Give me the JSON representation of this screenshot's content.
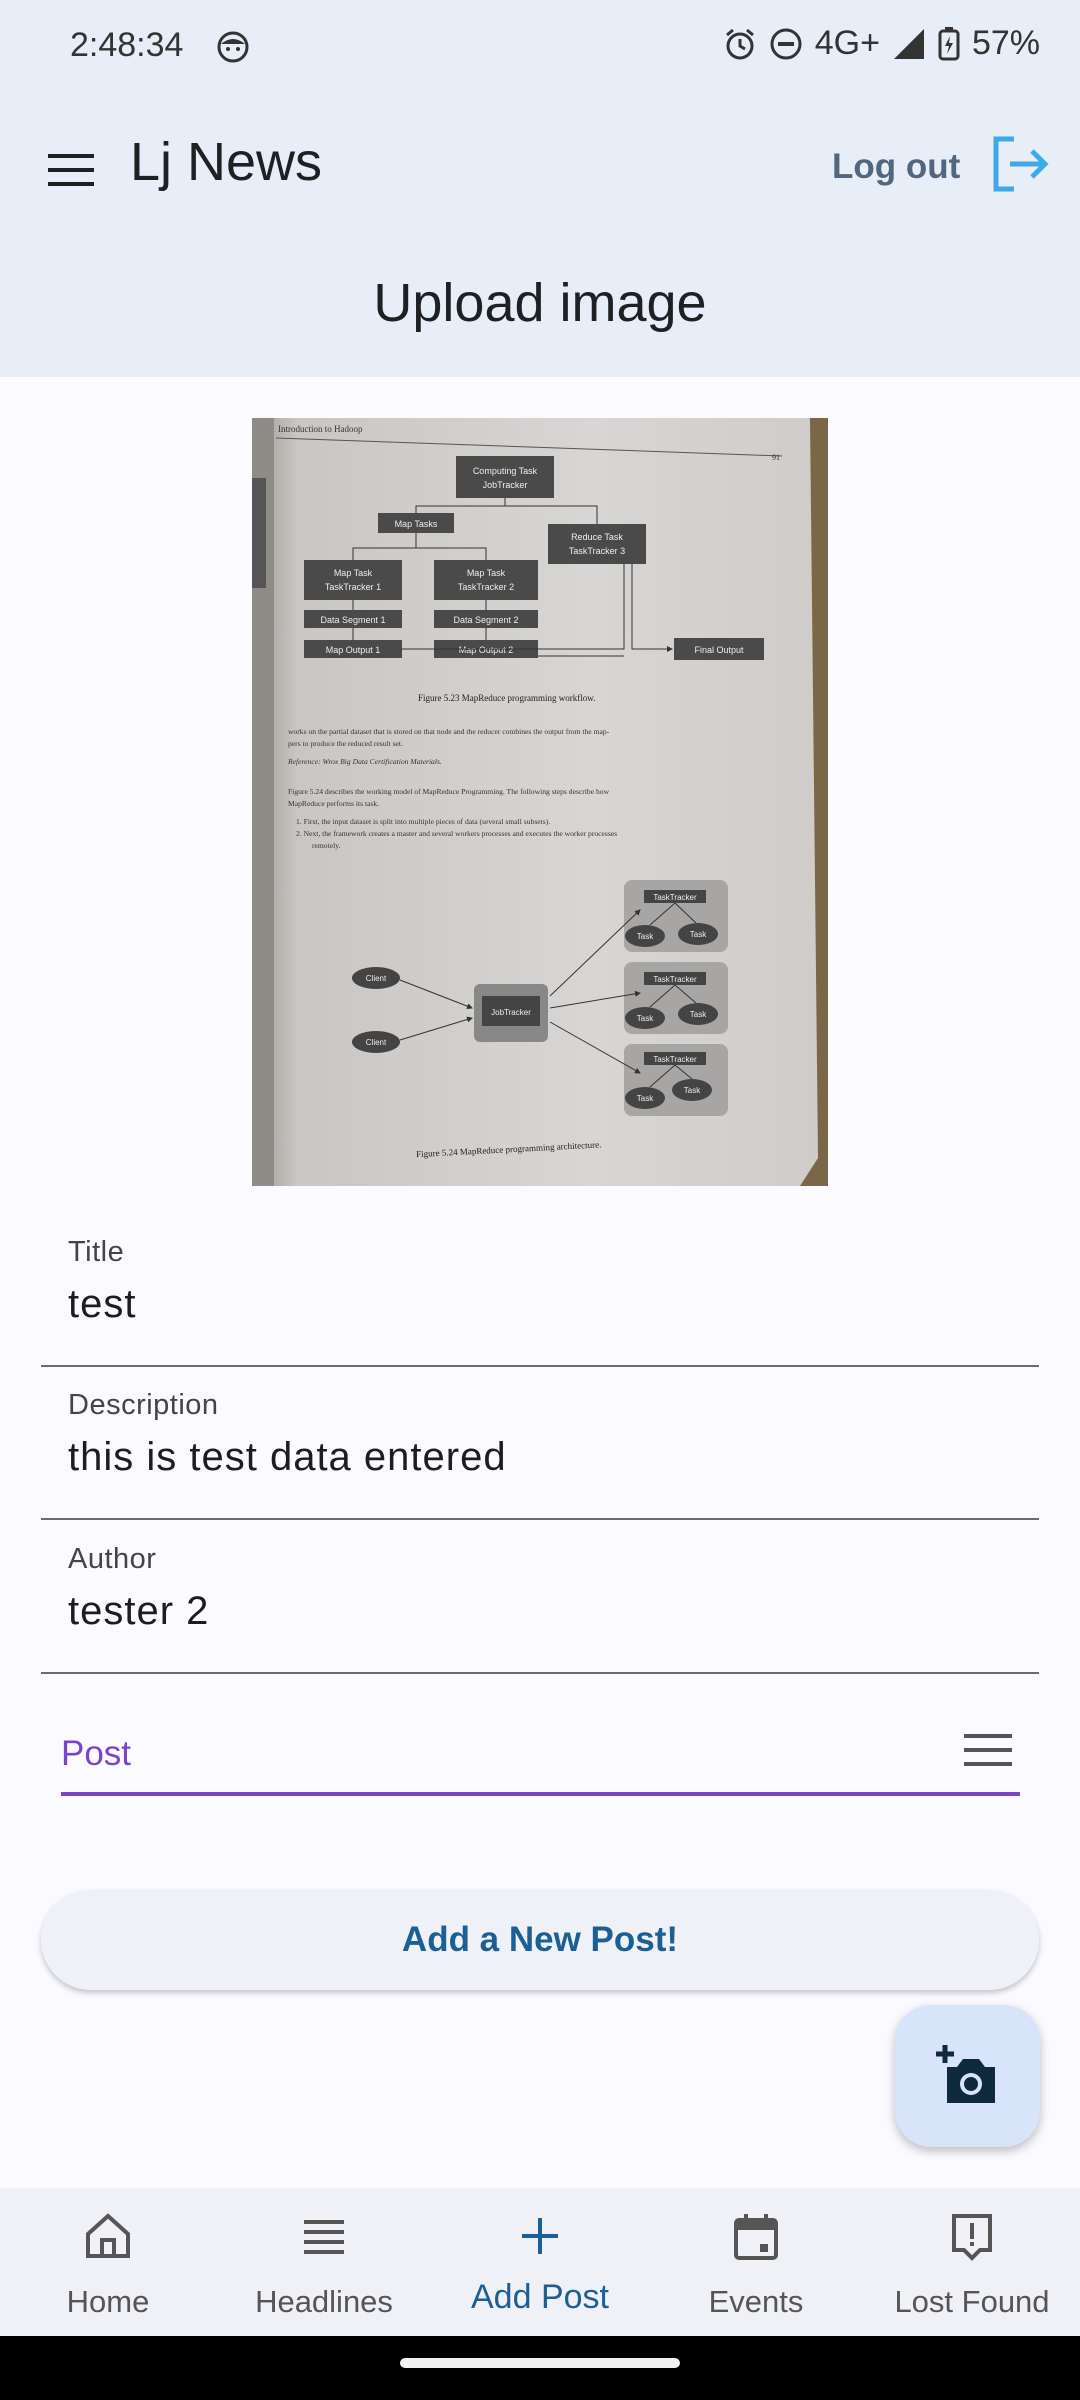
{
  "status_bar": {
    "time": "2:48:34",
    "network": "4G+",
    "battery": "57%"
  },
  "app_bar": {
    "title": "Lj News",
    "logout_label": "Log out"
  },
  "page": {
    "title": "Upload image"
  },
  "form": {
    "title_label": "Title",
    "title_value": "test",
    "description_label": "Description",
    "description_value": "this is test data entered",
    "author_label": "Author",
    "author_value": "tester 2",
    "category_value": "Post",
    "submit_label": "Add a New Post!"
  },
  "photo": {
    "page_header": "Introduction to Hadoop",
    "page_number": "91",
    "fig_5_23_nodes": {
      "computing_task": "Computing Task",
      "jobtracker": "JobTracker",
      "map_tasks": "Map Tasks",
      "reduce_task": "Reduce Task",
      "tasktracker_3": "TaskTracker 3",
      "map_task": "Map Task",
      "tasktracker_1": "TaskTracker 1",
      "tasktracker_2": "TaskTracker 2",
      "data_segment_1": "Data Segment 1",
      "data_segment_2": "Data Segment 2",
      "map_output_1": "Map Output 1",
      "map_output_2": "Map Output 2",
      "final_output": "Final Output"
    },
    "fig_5_23_caption": "Figure 5.23   MapReduce programming workflow.",
    "body_lines": [
      "works on the partial dataset that is stored on that node and the reducer combines the output from the map-",
      "pers to produce the reduced result set.",
      "Reference: Wrox Big Data Certification Materials.",
      "Figure 5.24 describes the working model of MapReduce Programming. The following steps describe how",
      "MapReduce performs its task.",
      "1. First, the input dataset is split into multiple pieces of data (several small subsets).",
      "2. Next, the framework creates a master and several workers processes and executes the worker processes",
      "remotely."
    ],
    "fig_5_24_nodes": {
      "client": "Client",
      "jobtracker": "JobTracker",
      "tasktracker": "TaskTracker",
      "task": "Task"
    },
    "fig_5_24_caption": "Figure 5.24   MapReduce programming architecture."
  },
  "bottom_nav": [
    {
      "label": "Home",
      "icon": "home-icon"
    },
    {
      "label": "Headlines",
      "icon": "list-icon"
    },
    {
      "label": "Add Post",
      "icon": "plus-icon",
      "active": true
    },
    {
      "label": "Events",
      "icon": "calendar-icon"
    },
    {
      "label": "Lost Found",
      "icon": "alert-box-icon"
    }
  ],
  "fab": {
    "icon": "add-photo-camera-icon"
  },
  "colors": {
    "header_bg": "#e7eef7",
    "accent_purple": "#7b45c8",
    "primary_blue": "#1b5f94",
    "logout_icon": "#3fa9e8"
  }
}
